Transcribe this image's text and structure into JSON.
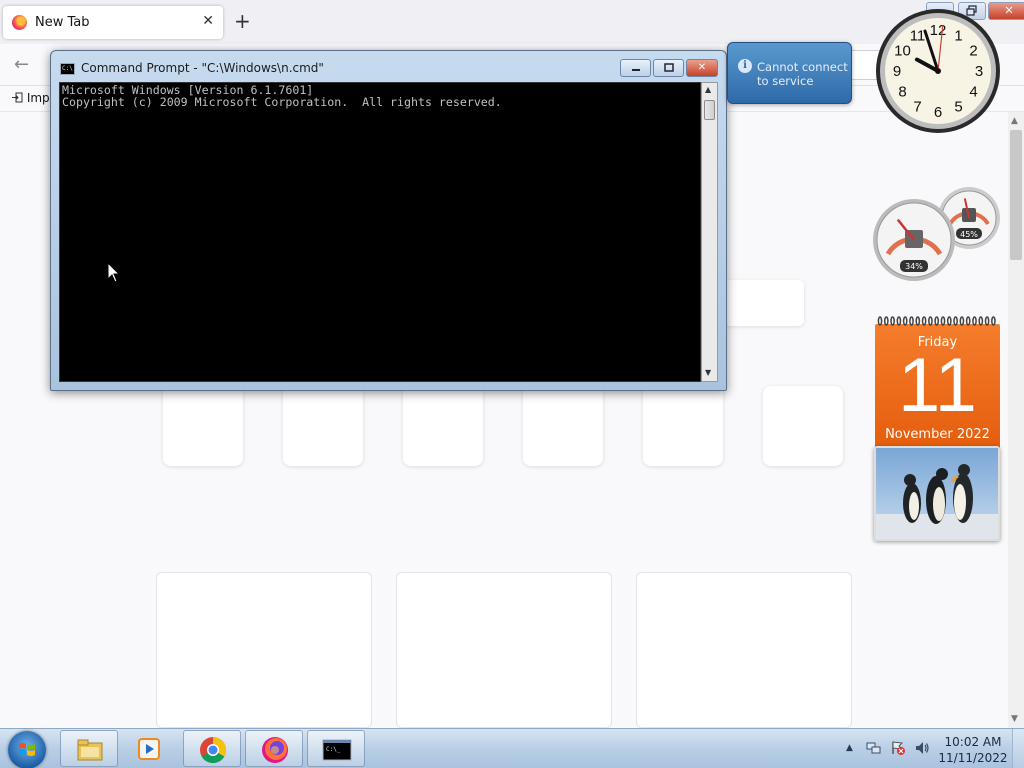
{
  "browser": {
    "tab_title": "New Tab",
    "tab_close": "✕",
    "new_tab": "+",
    "back": "←",
    "bookmark_label": "Imp"
  },
  "cmd": {
    "title": "Command Prompt - \"C:\\Windows\\n.cmd\"",
    "lines": [
      "Microsoft Windows [Version 6.1.7601]",
      "Copyright (c) 2009 Microsoft Corporation.  All rights reserved."
    ],
    "min": "▭",
    "max": "□",
    "close": "✕"
  },
  "notice": {
    "text_line1": "Cannot connect",
    "text_line2": "to service",
    "icon": "i"
  },
  "clock_gadget": {
    "hour": 9,
    "minute": 57,
    "second": 1
  },
  "cpu_gadget": {
    "cpu_percent": "34%",
    "memory_percent": "45%",
    "cpu": 34,
    "memory": 45
  },
  "calendar": {
    "day": "Friday",
    "date": "11",
    "month_year": "November 2022"
  },
  "taskbar": {
    "time": "10:02 AM",
    "date": "11/11/2022",
    "apps": [
      "windows-explorer",
      "media-player",
      "chrome",
      "firefox",
      "command-prompt"
    ],
    "cmd_icon_text": "C:\\_"
  },
  "colors": {
    "calendar_orange": "#ef6e1c",
    "notice_blue": "#3f7fbf",
    "cmd_bg": "#000000",
    "cmd_text": "#c0c0c0"
  }
}
